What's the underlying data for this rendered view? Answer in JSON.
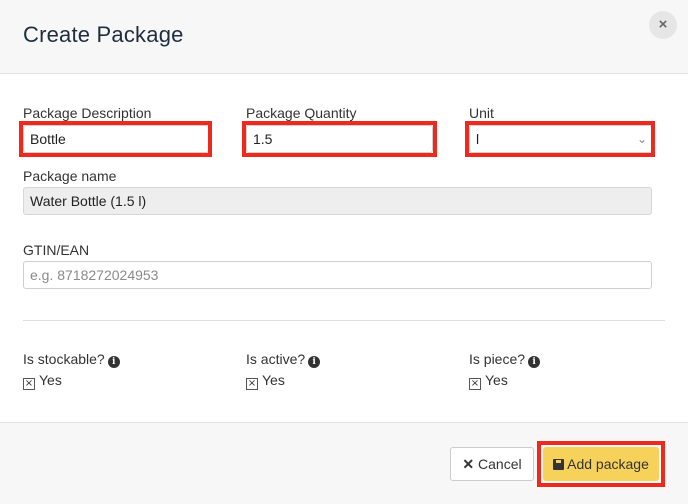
{
  "dialog": {
    "title": "Create Package",
    "close_symbol": "×"
  },
  "fields": {
    "package_description": {
      "label": "Package Description",
      "value": "Bottle"
    },
    "package_quantity": {
      "label": "Package Quantity",
      "value": "1.5"
    },
    "unit": {
      "label": "Unit",
      "value": "l"
    },
    "package_name": {
      "label": "Package name",
      "value": "Water Bottle (1.5 l)"
    },
    "gtin": {
      "label": "GTIN/EAN",
      "placeholder": "e.g. 8718272024953"
    }
  },
  "flags": [
    {
      "label": "Is stockable?",
      "check": "Yes"
    },
    {
      "label": "Is active?",
      "check": "Yes"
    },
    {
      "label": "Is piece?",
      "check": "Yes"
    }
  ],
  "footer": {
    "cancel_label": "Cancel",
    "add_label": "Add package"
  },
  "colors": {
    "highlight": "#ee2a1f",
    "primary_button": "#f7d25a"
  }
}
